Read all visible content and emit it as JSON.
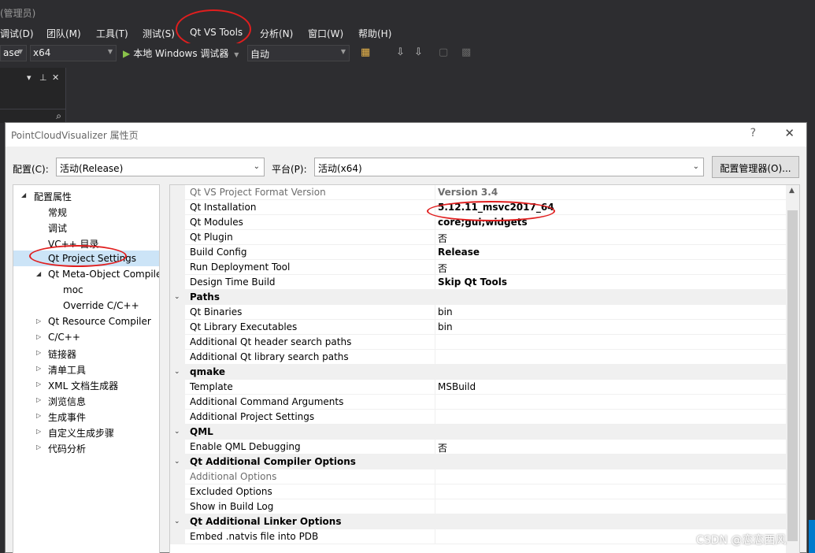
{
  "app": {
    "title_fragment": "(管理员)"
  },
  "menubar": {
    "items": [
      "调试(D)",
      "团队(M)",
      "工具(T)",
      "测试(S)",
      "Qt VS Tools",
      "分析(N)",
      "窗口(W)",
      "帮助(H)"
    ]
  },
  "toolbar": {
    "config_partial": "ase",
    "platform": "x64",
    "run_label": "本地 Windows 调试器",
    "mode": "自动"
  },
  "dialog": {
    "title": "PointCloudVisualizer 属性页",
    "help": "?",
    "close": "✕",
    "config_label": "配置(C):",
    "config_value": "活动(Release)",
    "platform_label": "平台(P):",
    "platform_value": "活动(x64)",
    "config_manager": "配置管理器(O)..."
  },
  "tree": [
    {
      "label": "配置属性",
      "exp": "◢"
    },
    {
      "label": "常规"
    },
    {
      "label": "调试"
    },
    {
      "label": "VC++ 目录"
    },
    {
      "label": "Qt Project Settings",
      "selected": true
    },
    {
      "label": "Qt Meta-Object Compile",
      "exp": "◢"
    },
    {
      "label": "moc"
    },
    {
      "label": "Override C/C++"
    },
    {
      "label": "Qt Resource Compiler",
      "exp": "▷"
    },
    {
      "label": "C/C++",
      "exp": "▷"
    },
    {
      "label": "链接器",
      "exp": "▷"
    },
    {
      "label": "清单工具",
      "exp": "▷"
    },
    {
      "label": "XML 文档生成器",
      "exp": "▷"
    },
    {
      "label": "浏览信息",
      "exp": "▷"
    },
    {
      "label": "生成事件",
      "exp": "▷"
    },
    {
      "label": "自定义生成步骤",
      "exp": "▷"
    },
    {
      "label": "代码分析",
      "exp": "▷"
    }
  ],
  "grid": [
    {
      "name": "Qt VS Project Format Version",
      "value": "Version 3.4",
      "dim": true,
      "bold": true
    },
    {
      "name": "Qt Installation",
      "value": "5.12.11_msvc2017_64",
      "bold": true
    },
    {
      "name": "Qt Modules",
      "value": "core;gui;widgets",
      "bold": true
    },
    {
      "name": "Qt Plugin",
      "value": "否"
    },
    {
      "name": "Build Config",
      "value": "Release",
      "bold": true
    },
    {
      "name": "Run Deployment Tool",
      "value": "否"
    },
    {
      "name": "Design Time Build",
      "value": "Skip Qt Tools",
      "bold": true
    },
    {
      "name": "Paths",
      "category": true
    },
    {
      "name": "Qt Binaries",
      "value": "bin"
    },
    {
      "name": "Qt Library Executables",
      "value": "bin"
    },
    {
      "name": "Additional Qt header search paths",
      "value": ""
    },
    {
      "name": "Additional Qt library search paths",
      "value": ""
    },
    {
      "name": "qmake",
      "category": true
    },
    {
      "name": "Template",
      "value": "MSBuild"
    },
    {
      "name": "Additional Command Arguments",
      "value": ""
    },
    {
      "name": "Additional Project Settings",
      "value": ""
    },
    {
      "name": "QML",
      "category": true
    },
    {
      "name": "Enable QML Debugging",
      "value": "否"
    },
    {
      "name": "Qt Additional Compiler Options",
      "category": true
    },
    {
      "name": "Additional Options",
      "value": "",
      "dim": true
    },
    {
      "name": "Excluded Options",
      "value": ""
    },
    {
      "name": "Show in Build Log",
      "value": ""
    },
    {
      "name": "Qt Additional Linker Options",
      "category": true
    },
    {
      "name": "Embed .natvis file into PDB",
      "value": ""
    }
  ],
  "watermark": "CSDN @恋恋西风"
}
